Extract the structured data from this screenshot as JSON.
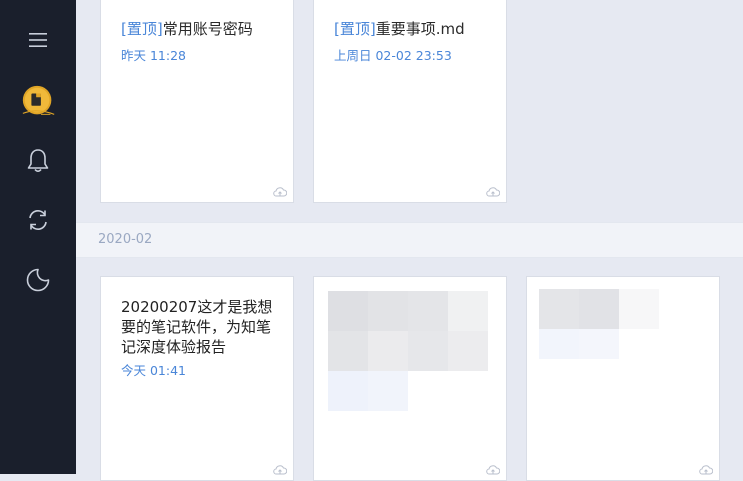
{
  "sidebar": {
    "icons": [
      "menu-icon",
      "avatar",
      "bell-icon",
      "sync-icon",
      "moon-icon"
    ]
  },
  "pinned": [
    {
      "pin_label": "[置顶]",
      "title": "常用账号密码",
      "time": "昨天 11:28"
    },
    {
      "pin_label": "[置顶]",
      "title": "重要事项.md",
      "time": "上周日 02-02 23:53"
    }
  ],
  "section": {
    "label": "2020-02"
  },
  "notes": [
    {
      "body": "20200207这才是我想要的笔记软件，为知笔记深度体验报告",
      "time": "今天 01:41"
    }
  ],
  "colors": {
    "sidebar_bg": "#1a1f2c",
    "accent": "#4a86d8",
    "page_bg": "#e6e9f2"
  }
}
